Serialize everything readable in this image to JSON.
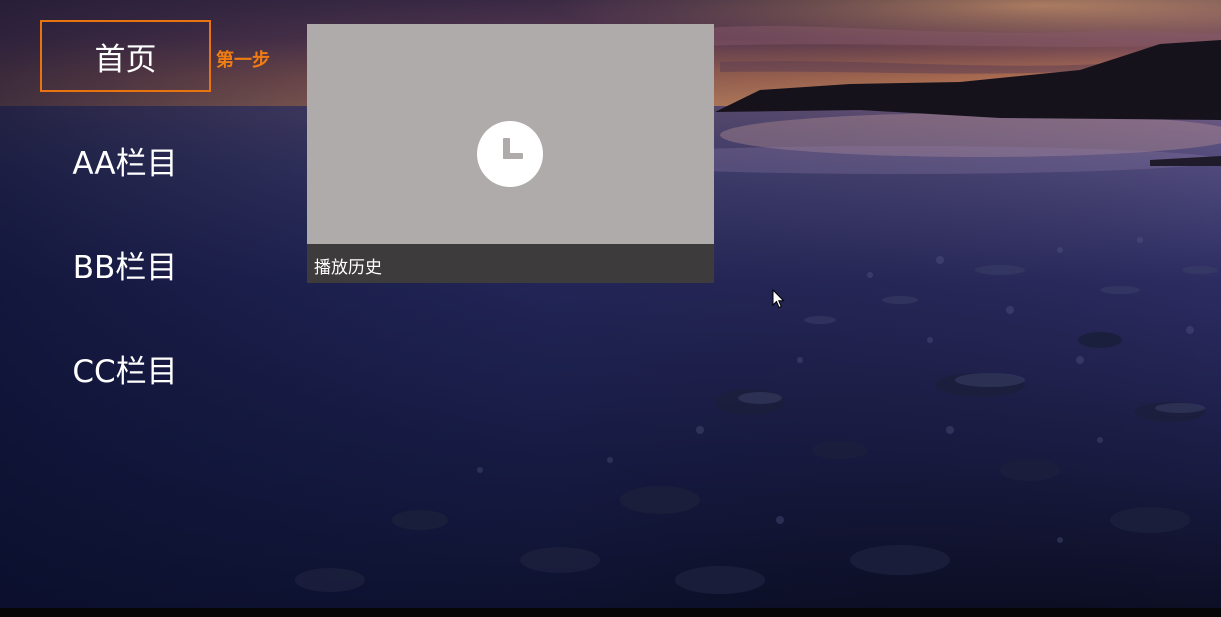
{
  "nav": {
    "items": [
      {
        "label": "首页",
        "focused": true
      },
      {
        "label": "AA栏目",
        "focused": false
      },
      {
        "label": "BB栏目",
        "focused": false
      },
      {
        "label": "CC栏目",
        "focused": false
      }
    ],
    "step_hint": "第一步"
  },
  "content": {
    "cards": [
      {
        "title": "播放历史",
        "icon": "clock-icon"
      }
    ]
  },
  "theme": {
    "focus_color": "#e8730f",
    "hint_color": "#f07d12",
    "card_thumb_color": "#afabaa",
    "card_caption_color": "#3d3b3c"
  },
  "background": {
    "scene": "lake-shore-at-dusk"
  }
}
